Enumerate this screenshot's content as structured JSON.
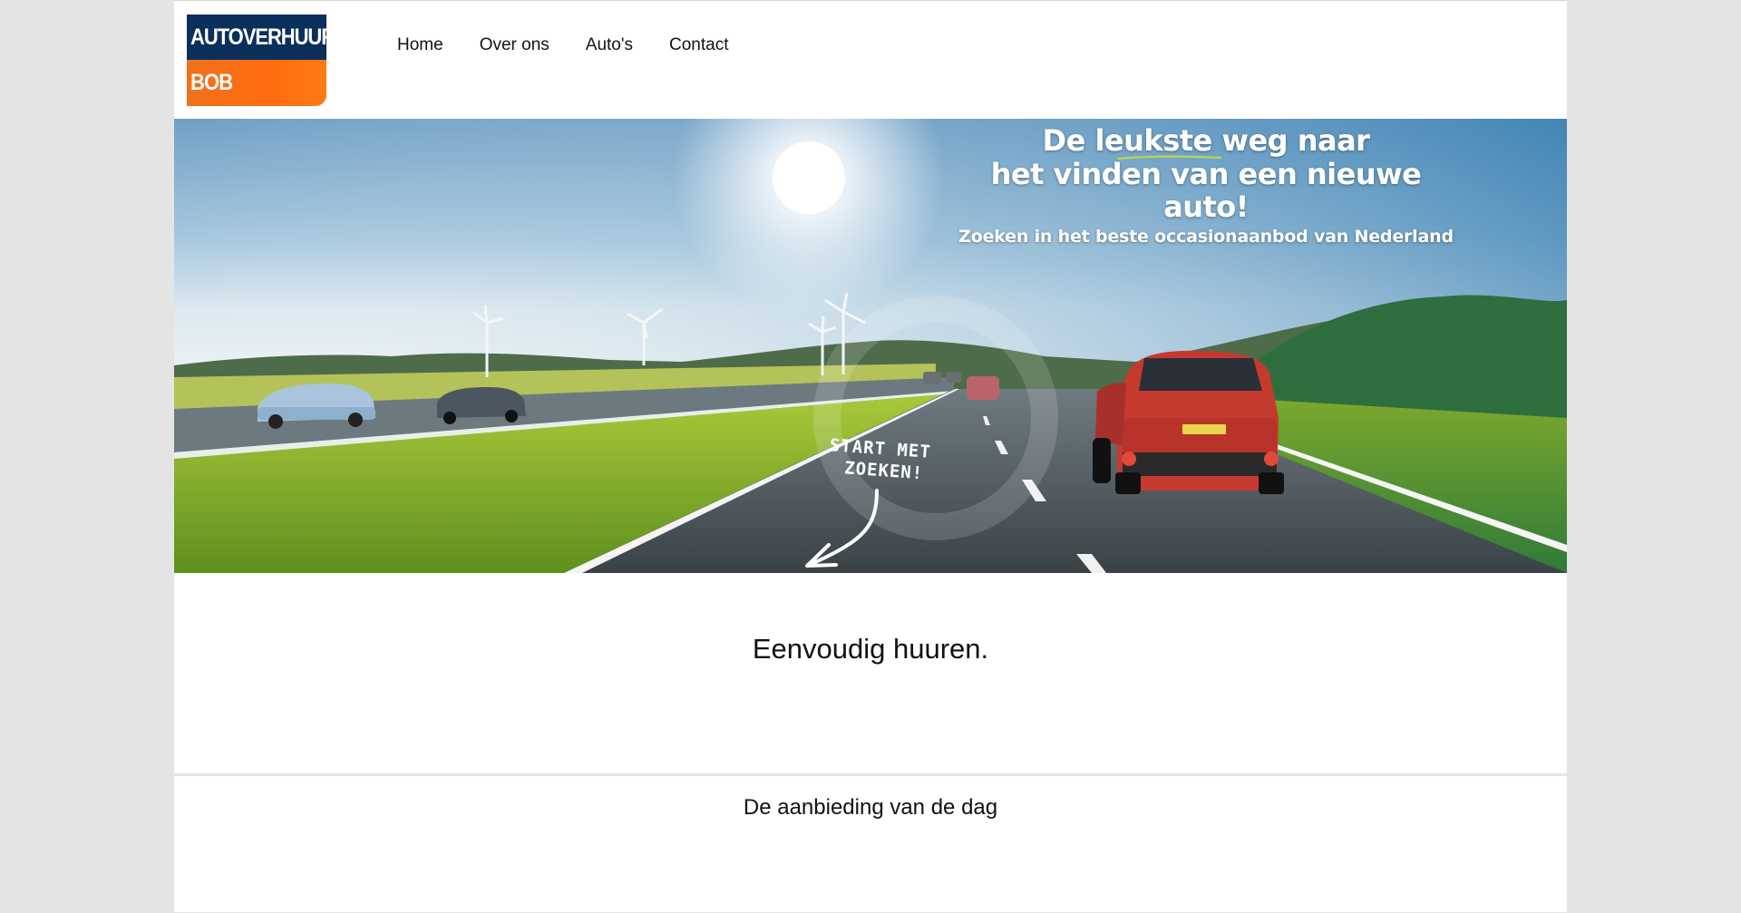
{
  "brand": {
    "line1": "AUTOVERHUUR",
    "line2": "BOB",
    "colors": {
      "navy": "#0b2f5b",
      "orange": "#ff6d0f"
    }
  },
  "nav": {
    "items": [
      {
        "label": "Home"
      },
      {
        "label": "Over ons"
      },
      {
        "label": "Auto's"
      },
      {
        "label": "Contact"
      }
    ]
  },
  "hero": {
    "headline_line1": "De leukste weg naar",
    "headline_line2": "het vinden van een nieuwe auto!",
    "subline": "Zoeken in het beste occasionaanbod van Nederland",
    "cta_line1": "START MET",
    "cta_line2": "ZOEKEN!"
  },
  "main": {
    "heading": "Eenvoudig huuren."
  },
  "offer": {
    "heading": "De aanbieding van de dag"
  }
}
